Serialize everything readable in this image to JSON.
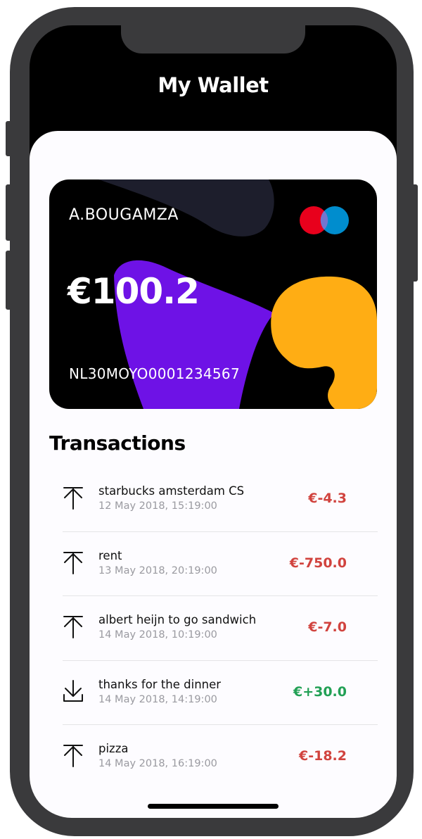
{
  "app": {
    "title": "My Wallet"
  },
  "card": {
    "holder": "A.BOUGAMZA",
    "balance": "€100.2",
    "iban": "NL30MOYO0001234567",
    "logo": "maestro-logo",
    "colors": {
      "background": "#000000",
      "purple_shape": "#6e12e6",
      "yellow_shape": "#ffad14",
      "grey_shape": "#1d1e2c",
      "logo_red": "#e8001c",
      "logo_blue": "#0099df"
    }
  },
  "transactions": {
    "heading": "Transactions",
    "items": [
      {
        "description": "starbucks amsterdam CS",
        "date": "12 May 2018, 15:19:00",
        "amount": "€-4.3",
        "direction": "outgoing",
        "icon": "upload-arrow-icon"
      },
      {
        "description": "rent",
        "date": "13 May 2018, 20:19:00",
        "amount": "€-750.0",
        "direction": "outgoing",
        "icon": "upload-arrow-icon"
      },
      {
        "description": "albert heijn to go sandwich",
        "date": "14 May 2018, 10:19:00",
        "amount": "€-7.0",
        "direction": "outgoing",
        "icon": "upload-arrow-icon"
      },
      {
        "description": "thanks for the dinner",
        "date": "14 May 2018, 14:19:00",
        "amount": "€+30.0",
        "direction": "incoming",
        "icon": "download-arrow-icon"
      },
      {
        "description": "pizza",
        "date": "14 May 2018, 16:19:00",
        "amount": "€-18.2",
        "direction": "outgoing",
        "icon": "upload-arrow-icon"
      }
    ]
  },
  "colors": {
    "negative": "#d1433e",
    "positive": "#22a055",
    "header_bg": "#000000",
    "sheet_bg": "#fdfcff"
  }
}
